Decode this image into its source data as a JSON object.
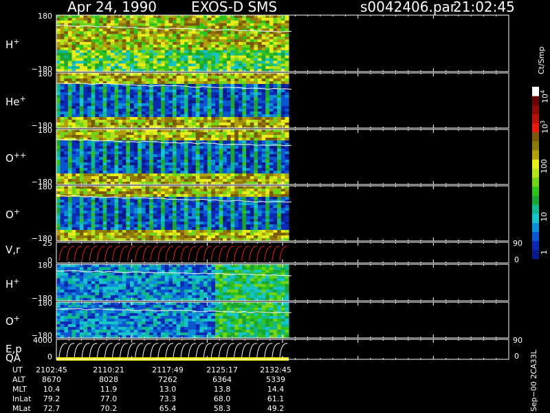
{
  "header": {
    "date": "Apr 24, 1990",
    "instrument": "EXOS-D SMS",
    "file": "s0042406.par",
    "time": "21:02:45"
  },
  "colorbar": {
    "unit": "Ct/Smp",
    "ticks": [
      "1",
      "10",
      "100",
      "10",
      "10"
    ],
    "exponents": [
      "",
      "",
      "",
      "3",
      "4"
    ],
    "colors": [
      "#0a1a8c",
      "#0a2ab4",
      "#0b55d0",
      "#0e8ed6",
      "#17c4cc",
      "#10b890",
      "#19a632",
      "#2fc21c",
      "#70d41a",
      "#b6e21a",
      "#e8ec1a",
      "#b0a010",
      "#8c7a0a",
      "#7a5a0a",
      "#e81a10",
      "#b8120c",
      "#8c0c08",
      "#640604",
      "#ffffff"
    ]
  },
  "chart_data": {
    "type": "heatmap",
    "panels": [
      {
        "label": "H",
        "charge": "+",
        "ymax_label": "180",
        "ymin_label": "−180",
        "kind": "spectrogram"
      },
      {
        "label": "He",
        "charge": "+",
        "ymax_label": "180",
        "ymin_label": "−180",
        "kind": "spectrogram"
      },
      {
        "label": "O",
        "charge": "++",
        "ymax_label": "180",
        "ymin_label": "−180",
        "kind": "spectrogram"
      },
      {
        "label": "O",
        "charge": "+",
        "ymax_label": "180",
        "ymin_label": "−180",
        "kind": "spectrogram"
      },
      {
        "label": "V,r",
        "charge": "",
        "ymax_label": "25",
        "ymin_label": "0",
        "right_top": "90",
        "right_bottom": "0",
        "kind": "line"
      },
      {
        "label": "H",
        "charge": "+",
        "ymax_label": "180",
        "ymin_label": "−180",
        "kind": "spectrogram"
      },
      {
        "label": "O",
        "charge": "+",
        "ymax_label": "180",
        "ymin_label": "−180",
        "kind": "spectrogram"
      },
      {
        "label": "E,p",
        "label2": "QA",
        "charge": "",
        "ymax_label": "4000",
        "ymin_label": "0",
        "right_top": "90",
        "right_bottom": "0",
        "kind": "line"
      }
    ],
    "x_axis": {
      "row_labels": [
        "UT",
        "ALT",
        "MLT",
        "InLat",
        "MLat"
      ],
      "columns": [
        {
          "UT": "2102:45",
          "ALT": "8670",
          "MLT": "10.4",
          "InLat": "79.2",
          "MLat": "72.7"
        },
        {
          "UT": "2110:21",
          "ALT": "8028",
          "MLT": "11.9",
          "InLat": "77.0",
          "MLat": "70.2"
        },
        {
          "UT": "2117:49",
          "ALT": "7262",
          "MLT": "13.0",
          "InLat": "73.3",
          "MLat": "65.4"
        },
        {
          "UT": "2125:17",
          "ALT": "6364",
          "MLT": "13.8",
          "InLat": "68.0",
          "MLat": "58.3"
        },
        {
          "UT": "2132:45",
          "ALT": "5339",
          "MLT": "14.4",
          "InLat": "61.1",
          "MLat": "49.2"
        }
      ]
    }
  },
  "side_note": "Sep−00 2CA33L"
}
